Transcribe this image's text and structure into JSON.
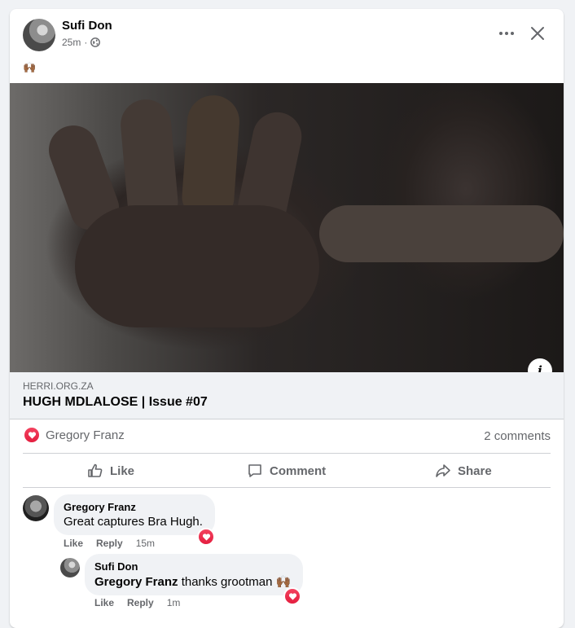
{
  "post": {
    "author": "Sufi Don",
    "time": "25m",
    "separator": "·",
    "body_emoji": "🙌🏾"
  },
  "link": {
    "domain": "HERRI.ORG.ZA",
    "title": "HUGH MDLALOSE | Issue #07"
  },
  "reactions": {
    "names": "Gregory Franz",
    "comments_count": "2 comments"
  },
  "actions": {
    "like": "Like",
    "comment": "Comment",
    "share": "Share"
  },
  "comments": [
    {
      "author": "Gregory Franz",
      "text": "Great captures Bra Hugh.",
      "like": "Like",
      "reply": "Reply",
      "time": "15m"
    },
    {
      "author": "Sufi Don",
      "mention": "Gregory Franz",
      "text": " thanks grootman ",
      "emoji": "🙌🏾",
      "like": "Like",
      "reply": "Reply",
      "time": "1m"
    }
  ],
  "colors": {
    "love": "#e41e3f",
    "muted_text": "#65676b",
    "bubble_bg": "#f0f2f5"
  },
  "icons": [
    "more-icon",
    "close-icon",
    "globe-icon",
    "info-icon",
    "heart-icon",
    "like-icon",
    "comment-icon",
    "share-icon"
  ]
}
